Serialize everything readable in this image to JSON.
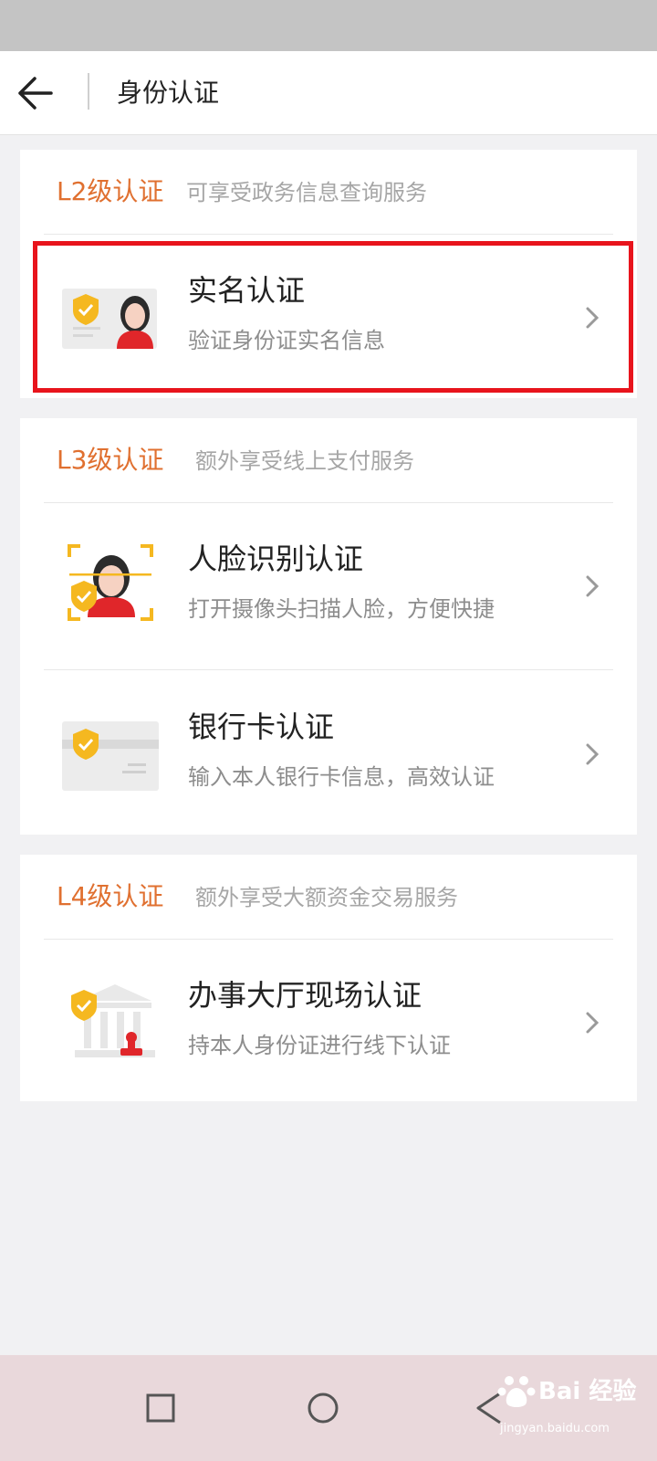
{
  "header": {
    "title": "身份认证"
  },
  "cards": [
    {
      "level": "L2级认证",
      "level_desc": "可享受政务信息查询服务",
      "items": [
        {
          "title": "实名认证",
          "subtitle": "验证身份证实名信息",
          "icon": "id-card-person-icon"
        }
      ]
    },
    {
      "level": "L3级认证",
      "level_desc": "额外享受线上支付服务",
      "items": [
        {
          "title": "人脸识别认证",
          "subtitle": "打开摄像头扫描人脸，方便快捷",
          "icon": "face-scan-icon"
        },
        {
          "title": "银行卡认证",
          "subtitle": "输入本人银行卡信息，高效认证",
          "icon": "bank-card-icon"
        }
      ]
    },
    {
      "level": "L4级认证",
      "level_desc": "额外享受大额资金交易服务",
      "items": [
        {
          "title": "办事大厅现场认证",
          "subtitle": "持本人身份证进行线下认证",
          "icon": "service-hall-icon"
        }
      ]
    }
  ],
  "watermark": {
    "text": "Bai 经验",
    "url": "jingyan.baidu.com"
  },
  "colors": {
    "accent": "#e07030",
    "highlight": "#e8141c",
    "shield": "#f5b820",
    "person": "#e0262a"
  }
}
